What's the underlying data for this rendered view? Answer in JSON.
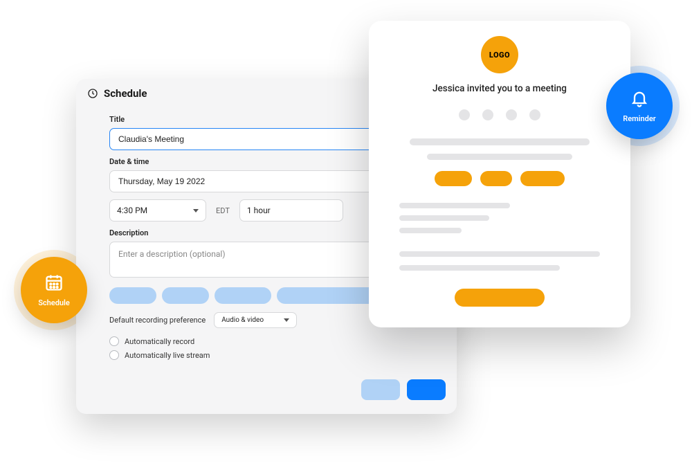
{
  "schedule_panel": {
    "header": "Schedule",
    "labels": {
      "title": "Title",
      "date_time": "Date & time",
      "description": "Description",
      "recording_pref": "Default recording preference"
    },
    "title_value": "Claudia's Meeting",
    "date_value": "Thursday, May 19 2022",
    "time_value": "4:30 PM",
    "timezone": "EDT",
    "duration_value": "1 hour",
    "description_placeholder": "Enter a description (optional)",
    "recording_pref_value": "Audio & video",
    "auto_record_label": "Automatically record",
    "auto_stream_label": "Automatically live stream"
  },
  "invite_card": {
    "logo_text": "LOGO",
    "title": "Jessica invited you to a meeting"
  },
  "badges": {
    "schedule_label": "Schedule",
    "reminder_label": "Reminder"
  },
  "colors": {
    "orange": "#f5a20a",
    "blue": "#0a7cff",
    "light_blue": "#b0d2f6",
    "grey": "#e4e4e6"
  }
}
